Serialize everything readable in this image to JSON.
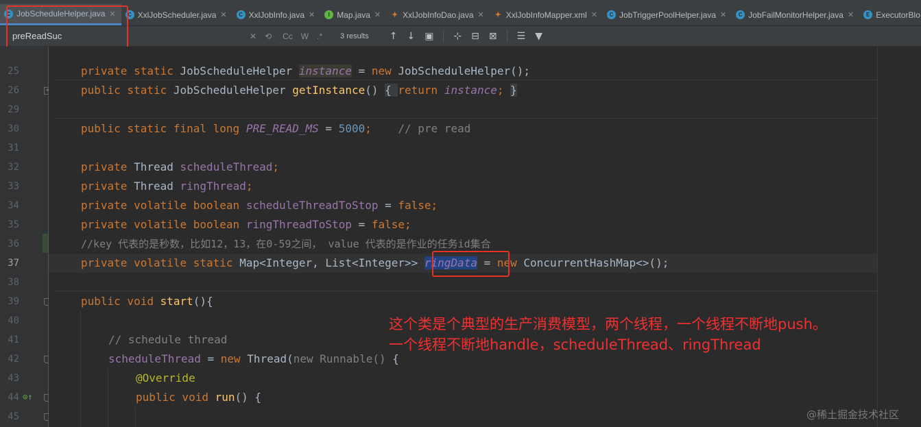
{
  "tabs": [
    {
      "label": "JobScheduleHelper.java",
      "icon": "class-icon",
      "active": true
    },
    {
      "label": "XxlJobScheduler.java",
      "icon": "class-icon"
    },
    {
      "label": "XxlJobInfo.java",
      "icon": "class-icon"
    },
    {
      "label": "Map.java",
      "icon": "interface-icon"
    },
    {
      "label": "XxlJobInfoDao.java",
      "icon": "mybatis-icon"
    },
    {
      "label": "XxlJobInfoMapper.xml",
      "icon": "mybatis-icon"
    },
    {
      "label": "JobTriggerPoolHelper.java",
      "icon": "class-icon"
    },
    {
      "label": "JobFailMonitorHelper.java",
      "icon": "class-icon"
    },
    {
      "label": "ExecutorBlo",
      "icon": "enum-icon"
    }
  ],
  "find": {
    "value": "preReadSuc",
    "match_case": "Cc",
    "words": "W",
    "regex": ".*",
    "results": "3 results"
  },
  "gutter": {
    "line_numbers": [
      "25",
      "26",
      "29",
      "30",
      "31",
      "32",
      "33",
      "34",
      "35",
      "36",
      "37",
      "38",
      "39",
      "40",
      "41",
      "42",
      "43",
      "44",
      "45"
    ],
    "current_line": "37"
  },
  "code": {
    "l25": {
      "p1": "private static ",
      "p2": "JobScheduleHelper ",
      "p3": "instance",
      "p4": " = ",
      "p5": "new ",
      "p6": "JobScheduleHelper();"
    },
    "l26": {
      "p1": "public static ",
      "p2": "JobScheduleHelper ",
      "p3": "getInstance",
      "p4": "() ",
      "p5": "{ ",
      "p6": "return ",
      "p7": "instance",
      "p8": "; ",
      "p9": "}"
    },
    "l30": {
      "p1": "public static final long ",
      "p2": "PRE_READ_MS",
      "p3": " = ",
      "p4": "5000",
      "p5": ";    ",
      "p6": "// pre read"
    },
    "l32": {
      "p1": "private ",
      "p2": "Thread ",
      "p3": "scheduleThread",
      "p4": ";"
    },
    "l33": {
      "p1": "private ",
      "p2": "Thread ",
      "p3": "ringThread",
      "p4": ";"
    },
    "l34": {
      "p1": "private volatile boolean ",
      "p2": "scheduleThreadToStop",
      "p3": " = ",
      "p4": "false;"
    },
    "l35": {
      "p1": "private volatile boolean ",
      "p2": "ringThreadToStop",
      "p3": " = ",
      "p4": "false;"
    },
    "l36": {
      "p1": "//key 代表的是秒数，比如12，13，在0-59之间， value 代表的是作业的任务id集合"
    },
    "l37": {
      "p1": "private volatile static ",
      "p2": "Map<Integer, List<Integer>> ",
      "p3": "ringData",
      "p4": " = ",
      "p5": "new ",
      "p6": "ConcurrentHashMap<>();"
    },
    "l39": {
      "p1": "public void ",
      "p2": "start",
      "p3": "(){"
    },
    "l41": {
      "p1": "// schedule thread"
    },
    "l42": {
      "p1": "scheduleThread",
      "p2": " = ",
      "p3": "new ",
      "p4": "Thread(",
      "p5": "new Runnable() ",
      "p6": "{"
    },
    "l43": {
      "p1": "@Override"
    },
    "l44": {
      "p1": "public void ",
      "p2": "run",
      "p3": "() {"
    }
  },
  "annotation": {
    "line1": "这个类是个典型的生产消费模型，两个线程，一个线程不断地push。",
    "line2": "一个线程不断地handle，scheduleThread、ringThread"
  },
  "watermark": "@稀土掘金技术社区",
  "colors": {
    "keyword": "#cc7832",
    "field": "#9876aa",
    "method": "#ffc66d",
    "number": "#6897bb",
    "comment": "#808080",
    "annotation": "#bbb529",
    "highlight_box": "#e5332a"
  }
}
